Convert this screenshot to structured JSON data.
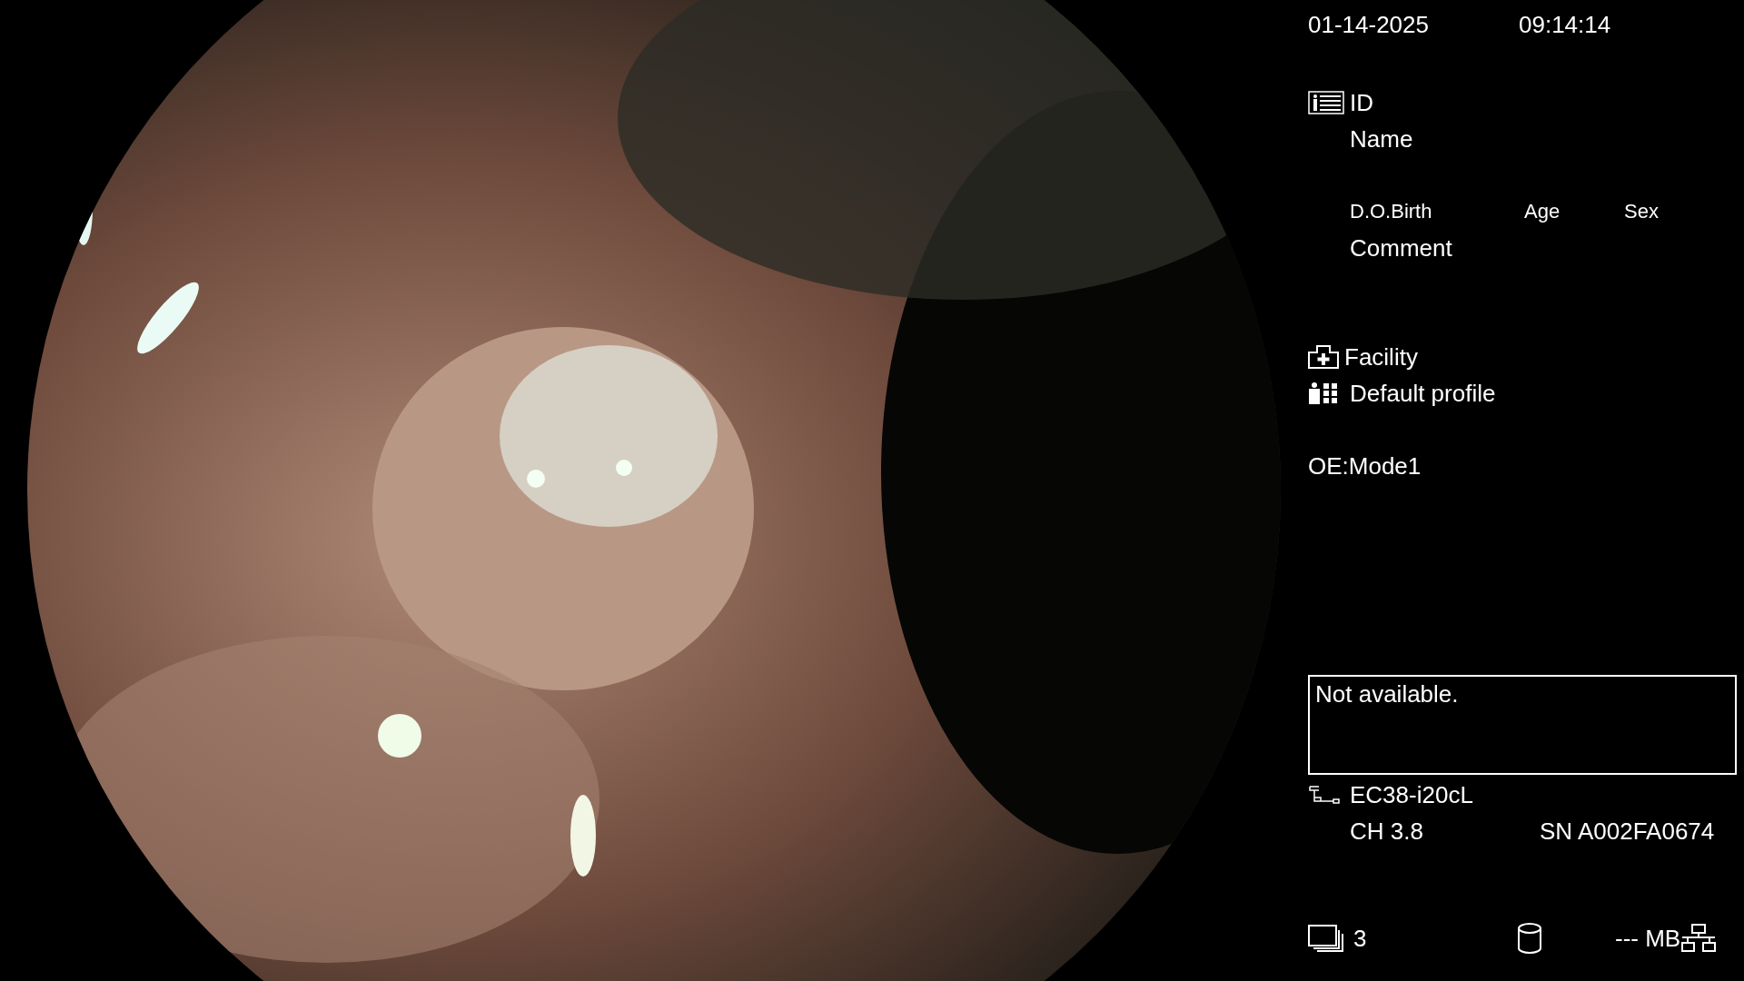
{
  "datetime": {
    "date": "01-14-2025",
    "time": "09:14:14"
  },
  "patient": {
    "id_label": "ID",
    "name_label": "Name",
    "dob_label": "D.O.Birth",
    "age_label": "Age",
    "sex_label": "Sex",
    "comment_label": "Comment"
  },
  "facility": "Facility",
  "profile": "Default profile",
  "mode": "OE:Mode1",
  "message": "Not available.",
  "scope": {
    "model": "EC38-i20cL",
    "channel": "CH 3.8",
    "serial": "SN A002FA0674"
  },
  "status_bar": {
    "image_count": "3",
    "storage": "--- MB"
  }
}
